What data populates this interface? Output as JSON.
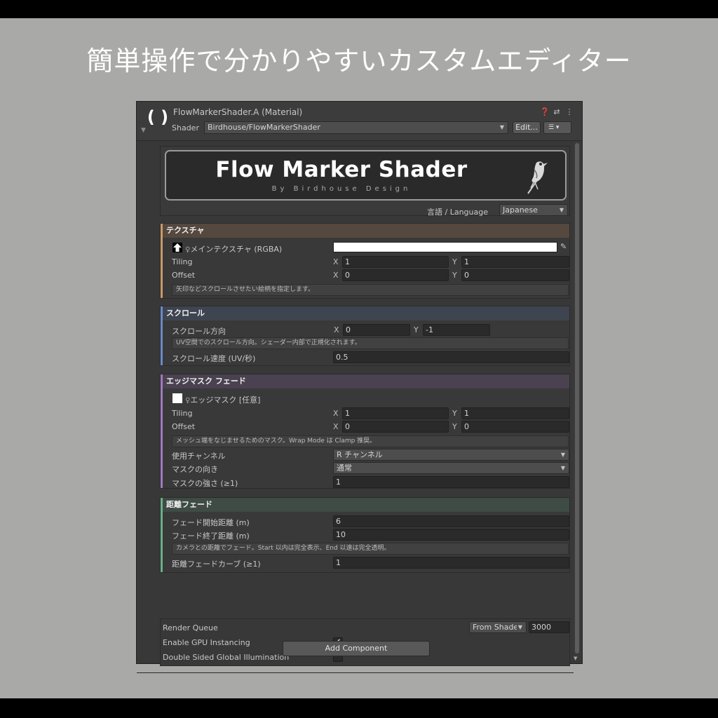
{
  "headline": "簡単操作で分かりやすいカスタムエディター",
  "header": {
    "material_icon": "unity-material-icon",
    "title": "FlowMarkerShader.A (Material)",
    "icons": [
      "help-icon",
      "preset-icon",
      "kebab-menu-icon"
    ],
    "shader_label": "Shader",
    "shader_value": "Birdhouse/FlowMarkerShader",
    "edit_label": "Edit...",
    "options_icon": "☰ ▾"
  },
  "banner": {
    "title": "Flow Marker Shader",
    "subtitle": "By Birdhouse Design"
  },
  "language": {
    "label": "言語 / Language",
    "value": "Japanese"
  },
  "texture": {
    "title": "テクスチャ",
    "accent": "#c89b6a",
    "head_bg": "#54483f",
    "main_tex_label": "メインテクスチャ (RGBA)",
    "tiling_label": "Tiling",
    "offset_label": "Offset",
    "x": "X",
    "y": "Y",
    "tiling_x": "1",
    "tiling_y": "1",
    "offset_x": "0",
    "offset_y": "0",
    "help": "矢印などスクロールさせたい絵柄を指定します。"
  },
  "scroll": {
    "title": "スクロール",
    "accent": "#6a8ac8",
    "head_bg": "#3e4550",
    "dir_label": "スクロール方向",
    "x": "X",
    "y": "Y",
    "dir_x": "0",
    "dir_y": "-1",
    "help": "UV空間でのスクロール方向。シェーダー内部で正規化されます。",
    "speed_label": "スクロール速度 (UV/秒)",
    "speed_value": "0.5"
  },
  "edge": {
    "title": "エッジマスク フェード",
    "accent": "#a07ac0",
    "head_bg": "#4a4250",
    "mask_label": "エッジマスク [任意]",
    "tiling_label": "Tiling",
    "offset_label": "Offset",
    "x": "X",
    "y": "Y",
    "tiling_x": "1",
    "tiling_y": "1",
    "offset_x": "0",
    "offset_y": "0",
    "help": "メッシュ端をなじませるためのマスク。Wrap Mode は Clamp 推奨。",
    "channel_label": "使用チャンネル",
    "channel_value": "R チャンネル",
    "direction_label": "マスクの向き",
    "direction_value": "通常",
    "strength_label": "マスクの強さ (≥1)",
    "strength_value": "1"
  },
  "distance": {
    "title": "距離フェード",
    "accent": "#6ab08a",
    "head_bg": "#3f4b45",
    "start_label": "フェード開始距離 (m)",
    "start_value": "6",
    "end_label": "フェード終了距離 (m)",
    "end_value": "10",
    "help": "カメラとの距離でフェード。Start 以内は完全表示、End 以遠は完全透明。",
    "curve_label": "距離フェードカーブ (≥1)",
    "curve_value": "1"
  },
  "bottom": {
    "render_queue_label": "Render Queue",
    "render_queue_mode": "From Shader",
    "render_queue_value": "3000",
    "gpu_instancing_label": "Enable GPU Instancing",
    "gpu_instancing_checked": true,
    "dsgi_label": "Double Sided Global Illumination",
    "dsgi_checked": false,
    "add_component": "Add Component"
  }
}
